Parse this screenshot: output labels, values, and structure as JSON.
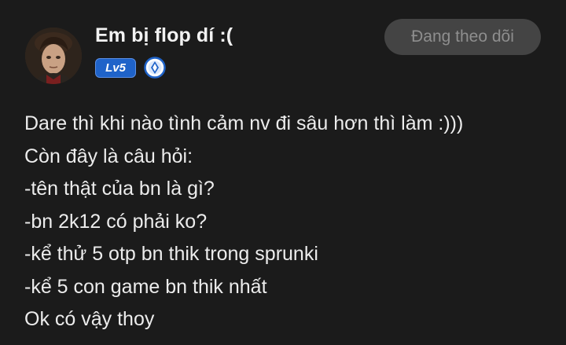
{
  "author": {
    "name": "Em bị flop dí :(",
    "level": "Lv5",
    "verified_icon": "verified-badge-icon",
    "avatar": "avatar-photo"
  },
  "actions": {
    "follow_label": "Đang theo dõi"
  },
  "post": {
    "lines": [
      "Dare thì khi nào tình cảm nv đi sâu hơn thì làm :)))",
      "Còn đây là câu hỏi:",
      "-tên thật của bn là gì?",
      "-bn 2k12 có phải ko?",
      "-kể thử 5 otp bn thik trong sprunki",
      "-kể 5 con game bn thik nhất",
      "Ok có vậy thoy"
    ]
  },
  "colors": {
    "background": "#1b1b1b",
    "text": "#ececec",
    "level_badge": "#1f63c9",
    "follow_button_bg": "#444444",
    "follow_button_text": "#8e8e8e"
  }
}
